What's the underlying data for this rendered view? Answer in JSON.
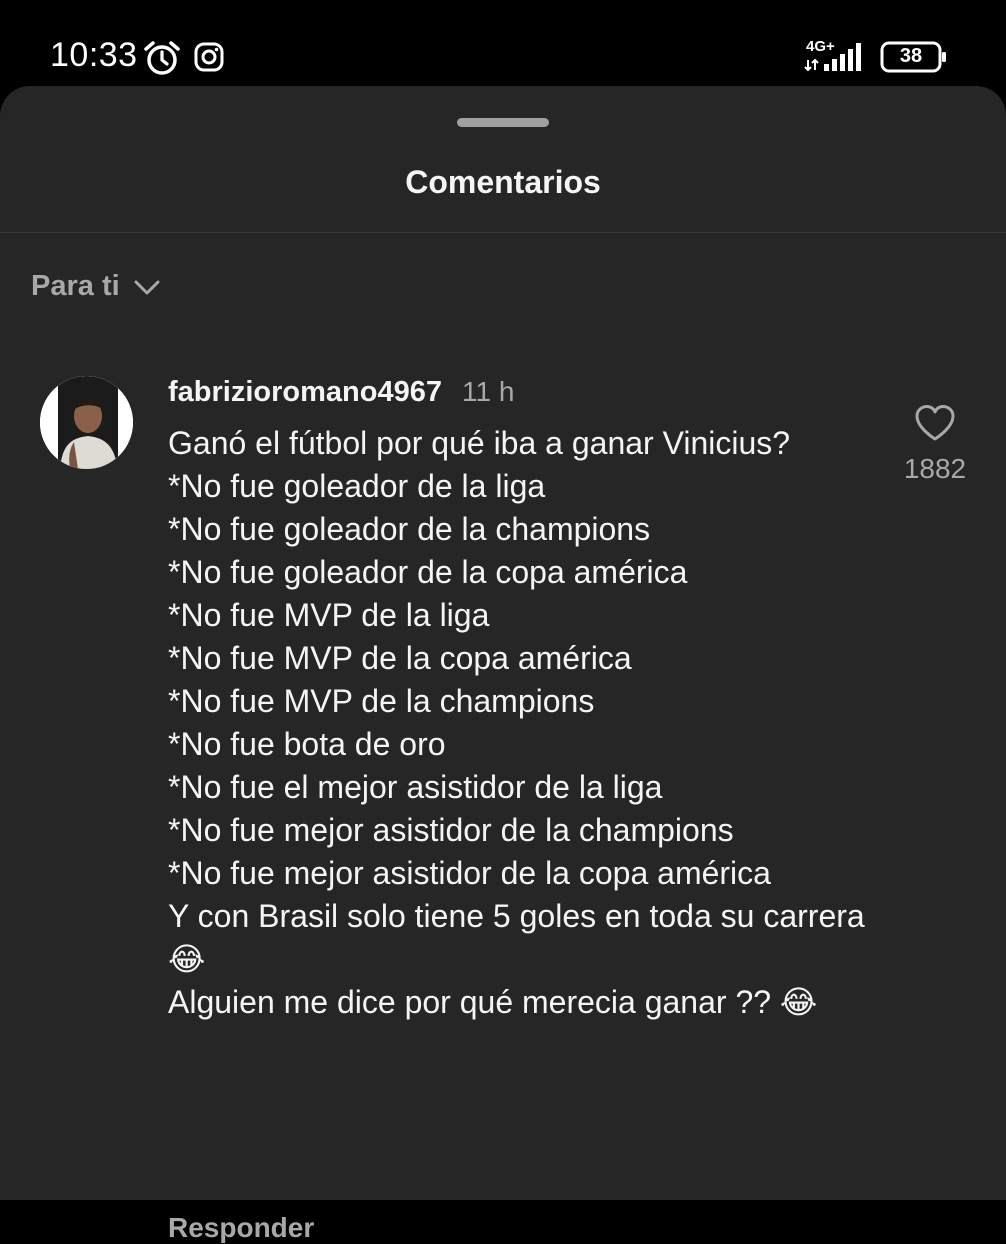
{
  "status_bar": {
    "time": "10:33",
    "network": "4G+",
    "battery": "38",
    "icons": [
      "alarm-icon",
      "instagram-icon",
      "signal-icon",
      "battery-icon"
    ]
  },
  "sheet": {
    "title": "Comentarios",
    "sort_label": "Para ti"
  },
  "comment": {
    "username": "fabrizioromano4967",
    "time_ago": "11 h",
    "text": "Ganó el fútbol por qué iba a ganar Vinicius?\n*No fue goleador de la liga\n*No fue goleador de la champions\n*No fue goleador de la copa américa\n*No fue MVP de la liga\n*No fue MVP de la copa américa\n*No fue MVP de la champions\n*No fue bota de oro\n*No fue el mejor asistidor de la liga\n*No fue mejor asistidor de la champions\n*No fue mejor asistidor de la copa américa\nY con Brasil solo tiene 5 goles en toda su carrera 😂\nAlguien me dice por qué merecia ganar ?? 😂",
    "like_count": "1882",
    "reply_label": "Responder"
  },
  "colors": {
    "background": "#000000",
    "sheet": "#262626",
    "primary_text": "#f5f5f5",
    "secondary_text": "#a8a8a8"
  }
}
